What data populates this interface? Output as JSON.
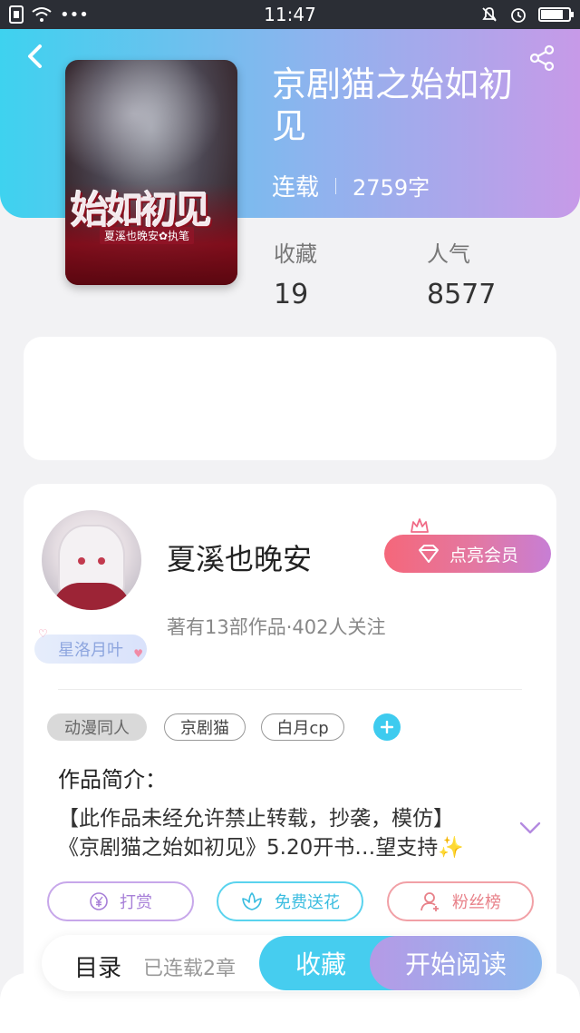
{
  "status_bar": {
    "time": "11:47",
    "more": "•••",
    "battery_level": 0.8
  },
  "book": {
    "title": "京剧猫之始如初见",
    "status": "连载",
    "word_count": "2759字",
    "cover_title": "始如初见",
    "cover_author": "夏溪也晚安✿执笔"
  },
  "stats": {
    "favorites_label": "收藏",
    "favorites_value": "19",
    "popularity_label": "人气",
    "popularity_value": "8577"
  },
  "author": {
    "name": "夏溪也晚安",
    "stats_text": "著有13部作品·402人关注",
    "badge": "星洛月叶",
    "vip_label": "点亮会员"
  },
  "tags": [
    "动漫同人",
    "京剧猫",
    "白月cp"
  ],
  "intro": {
    "label": "作品简介：",
    "line1": "【此作品未经允许禁止转载，抄袭，模仿】",
    "line2": "《京剧猫之始如初见》5.20开书…望支持✨"
  },
  "actions": {
    "reward": "打赏",
    "flower": "免费送花",
    "fans": "粉丝榜"
  },
  "bottom_bar": {
    "toc": "目录",
    "toc_sub": "已连载2章",
    "collect": "收藏",
    "read": "开始阅读"
  },
  "colors": {
    "header_start": "#3ed2ef",
    "header_end": "#c79ae8",
    "accent_blue": "#46cdef",
    "accent_purple": "#b59ae6",
    "vip_pink": "#f5677a"
  },
  "icons": {
    "back": "chevron-left-icon",
    "share": "share-icon",
    "expand": "chevron-down-icon",
    "reward": "yen-coin-icon",
    "flower": "flower-icon",
    "fans": "person-icon",
    "vip": "diamond-icon"
  }
}
